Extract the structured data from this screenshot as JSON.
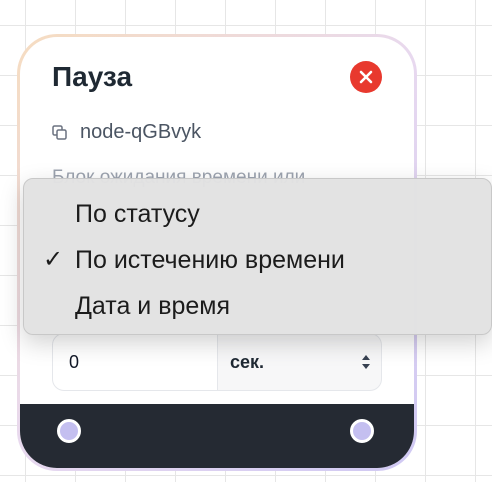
{
  "node": {
    "title": "Пауза",
    "id_text": "node-qGBvyk",
    "description": "Блок ожидания времени или",
    "duration_value": "0",
    "unit_selected": "сек."
  },
  "menu": {
    "items": [
      {
        "label": "По статусу",
        "checked": false
      },
      {
        "label": "По истечению времени",
        "checked": true
      },
      {
        "label": "Дата и время",
        "checked": false
      }
    ],
    "check_mark": "✓"
  },
  "colors": {
    "close_button": "#e8392e",
    "footer": "#252a33",
    "handle": "#c4bff0",
    "menu_bg": "#e2e2e2"
  },
  "icons": {
    "close": "close-icon",
    "copy": "copy-icon",
    "stepper": "chevron-updown-icon",
    "check": "checkmark-icon"
  }
}
